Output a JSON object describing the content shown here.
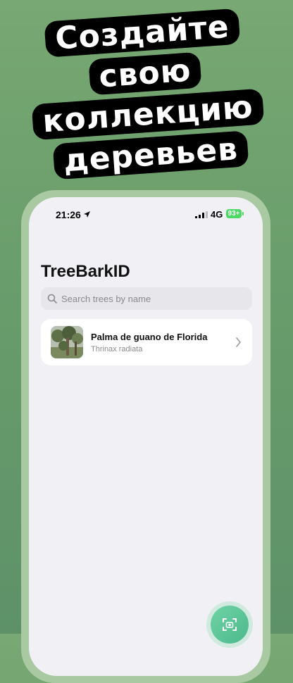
{
  "headline": {
    "lines": [
      "Создайте",
      "свою",
      "коллекцию",
      "деревьев"
    ]
  },
  "status_bar": {
    "time": "21:26",
    "network": "4G",
    "battery": "93+"
  },
  "app": {
    "title": "TreeBarkID",
    "search_placeholder": "Search trees by name"
  },
  "trees": [
    {
      "name": "Palma de guano de Florida",
      "scientific_name": "Thrinax radiata"
    }
  ],
  "icons": {
    "location": "location-arrow-icon",
    "signal": "signal-bars-icon",
    "battery": "battery-icon",
    "search": "search-icon",
    "chevron": "chevron-right-icon",
    "scan": "camera-scan-icon"
  },
  "colors": {
    "background": "#6a9e6c",
    "fab": "#5cc69a",
    "battery": "#4cd964"
  }
}
